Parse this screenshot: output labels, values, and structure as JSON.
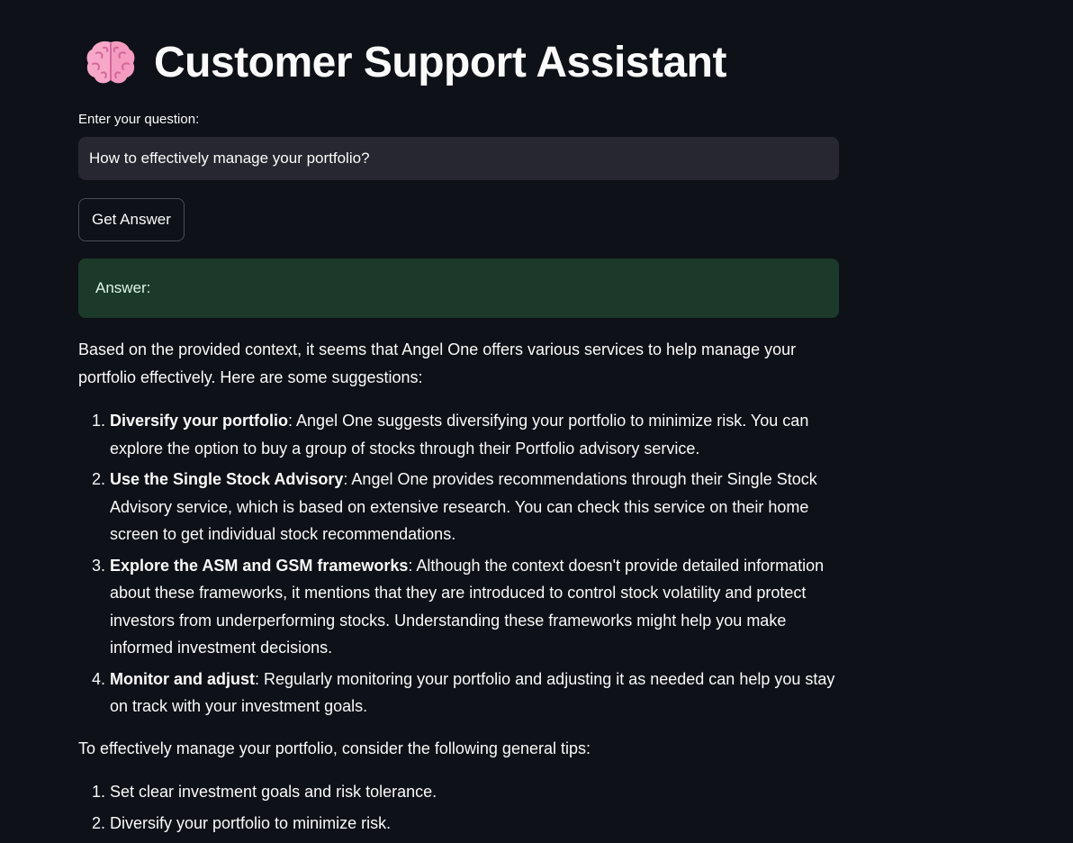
{
  "header": {
    "title": "Customer Support Assistant",
    "icon": "brain-icon"
  },
  "question": {
    "label": "Enter your question:",
    "value": "How to effectively manage your portfolio?"
  },
  "actions": {
    "get_answer_label": "Get Answer"
  },
  "answer": {
    "banner_label": "Answer:",
    "intro": "Based on the provided context, it seems that Angel One offers various services to help manage your portfolio effectively. Here are some suggestions:",
    "suggestions": [
      {
        "heading": "Diversify your portfolio",
        "text": ": Angel One suggests diversifying your portfolio to minimize risk. You can explore the option to buy a group of stocks through their Portfolio advisory service."
      },
      {
        "heading": "Use the Single Stock Advisory",
        "text": ": Angel One provides recommendations through their Single Stock Advisory service, which is based on extensive research. You can check this service on their home screen to get individual stock recommendations."
      },
      {
        "heading": "Explore the ASM and GSM frameworks",
        "text": ": Although the context doesn't provide detailed information about these frameworks, it mentions that they are introduced to control stock volatility and protect investors from underperforming stocks. Understanding these frameworks might help you make informed investment decisions."
      },
      {
        "heading": "Monitor and adjust",
        "text": ": Regularly monitoring your portfolio and adjusting it as needed can help you stay on track with your investment goals."
      }
    ],
    "tips_intro": "To effectively manage your portfolio, consider the following general tips:",
    "tips": [
      "Set clear investment goals and risk tolerance.",
      "Diversify your portfolio to minimize risk."
    ]
  },
  "colors": {
    "background": "#0e1117",
    "input_background": "#262730",
    "success_background": "#1b3a29",
    "text": "#fafafa"
  }
}
